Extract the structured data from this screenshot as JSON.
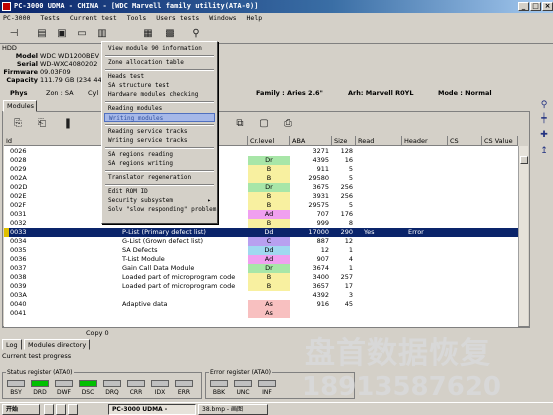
{
  "window": {
    "title": "PC-3000 UDMA - CHINA - [WDC Marvell family utility(ATA-0)]"
  },
  "menubar": [
    "PC-3000",
    "Tests",
    "Current test",
    "Tools",
    "Users tests",
    "Windows",
    "Help"
  ],
  "hdd": {
    "header": "HDD",
    "fields": [
      {
        "label": "Model",
        "value": "WDC WD1200BEV"
      },
      {
        "label": "Serial",
        "value": "WD-WXC4080202"
      },
      {
        "label": "Firmware",
        "value": "09.03F09"
      },
      {
        "label": "Capacity",
        "value": "111.79 GB (234 44"
      }
    ]
  },
  "infostrip": {
    "phys": "Phys",
    "zon": "Zon : SA",
    "cyl": "Cyl",
    "family": "Family : Aries 2.6\"",
    "arh": "Arh: Marvell R0YL",
    "mode": "Mode : Normal"
  },
  "tabs": {
    "modules": "Modules",
    "log": "Log",
    "modules_directory": "Modules directory"
  },
  "context_menu": [
    {
      "label": "View module 90 information",
      "highlight": false
    },
    {
      "sep": true
    },
    {
      "label": "Zone allocation table",
      "highlight": false
    },
    {
      "sep": true
    },
    {
      "label": "Heads test",
      "highlight": false
    },
    {
      "label": "SA structure test",
      "highlight": false
    },
    {
      "label": "Hardware modules checking",
      "highlight": false
    },
    {
      "sep": true
    },
    {
      "label": "Reading modules",
      "highlight": false
    },
    {
      "label": "Writing modules",
      "highlight": true
    },
    {
      "sep": true
    },
    {
      "label": "Reading service tracks",
      "highlight": false
    },
    {
      "label": "Writing service tracks",
      "highlight": false
    },
    {
      "sep": true
    },
    {
      "label": "SA regions reading",
      "highlight": false
    },
    {
      "label": "SA regions writing",
      "highlight": false
    },
    {
      "sep": true
    },
    {
      "label": "Translator regeneration",
      "highlight": false
    },
    {
      "sep": true
    },
    {
      "label": "Edit ROM ID",
      "highlight": false
    },
    {
      "label": "Security subsystem",
      "highlight": false,
      "submenu": true
    },
    {
      "label": "Solv \"slow responding\" problem",
      "highlight": false
    }
  ],
  "submenu_arrow": "▸",
  "chart_data": {
    "type": "table",
    "columns": [
      "Id",
      "",
      "Cr.level",
      "ABA",
      "Size",
      "Read",
      "Header",
      "CS",
      "CS Value"
    ],
    "rows": [
      {
        "id": "0026",
        "name": "",
        "level": "",
        "aba": "3271",
        "size": "128",
        "read": "",
        "header": "",
        "color": ""
      },
      {
        "id": "0028",
        "name": "",
        "level": "Dr",
        "aba": "4395",
        "size": "16",
        "read": "",
        "header": "",
        "color": "#a8e6a8"
      },
      {
        "id": "0029",
        "name": "ode",
        "level": "B",
        "aba": "911",
        "size": "5",
        "read": "",
        "header": "",
        "color": "#f8f0a0"
      },
      {
        "id": "002A",
        "name": "ode",
        "level": "B",
        "aba": "29580",
        "size": "5",
        "read": "",
        "header": "",
        "color": "#f8f0a0"
      },
      {
        "id": "002D",
        "name": "",
        "level": "Dr",
        "aba": "3675",
        "size": "256",
        "read": "",
        "header": "",
        "color": "#a8e6a8"
      },
      {
        "id": "002E",
        "name": "ode",
        "level": "B",
        "aba": "3931",
        "size": "256",
        "read": "",
        "header": "",
        "color": "#f8f0a0"
      },
      {
        "id": "002F",
        "name": "ode",
        "level": "B",
        "aba": "29575",
        "size": "5",
        "read": "",
        "header": "",
        "color": "#f8f0a0"
      },
      {
        "id": "0031",
        "name": "",
        "level": "Ad",
        "aba": "707",
        "size": "176",
        "read": "",
        "header": "",
        "color": "#f0a0f0"
      },
      {
        "id": "0032",
        "name": "Relo bad block module",
        "level": "B",
        "aba": "999",
        "size": "8",
        "read": "",
        "header": "",
        "color": "#f8f0a0"
      },
      {
        "id": "0033",
        "name": "P-List (Primary defect list)",
        "level": "Dd",
        "aba": "17000",
        "size": "290",
        "read": "Yes",
        "header": "Error",
        "color": "#a0c8f0",
        "selected": true
      },
      {
        "id": "0034",
        "name": "G-List (Grown defect list)",
        "level": "C",
        "aba": "887",
        "size": "12",
        "read": "",
        "header": "",
        "color": "#b8a0f0"
      },
      {
        "id": "0035",
        "name": "SA Defects",
        "level": "Dd",
        "aba": "12",
        "size": "1",
        "read": "",
        "header": "",
        "color": "#a0d8f0"
      },
      {
        "id": "0036",
        "name": "T-List Module",
        "level": "Ad",
        "aba": "907",
        "size": "4",
        "read": "",
        "header": "",
        "color": "#f0a0f0"
      },
      {
        "id": "0037",
        "name": "Gain Call Data Module",
        "level": "Dr",
        "aba": "3674",
        "size": "1",
        "read": "",
        "header": "",
        "color": "#a8e6a8"
      },
      {
        "id": "0038",
        "name": "Loaded part of microprogram code",
        "level": "B",
        "aba": "3400",
        "size": "257",
        "read": "",
        "header": "",
        "color": "#f8f0a0"
      },
      {
        "id": "0039",
        "name": "Loaded part of microprogram code",
        "level": "B",
        "aba": "3657",
        "size": "17",
        "read": "",
        "header": "",
        "color": "#f8f0a0"
      },
      {
        "id": "003A",
        "name": "",
        "level": "",
        "aba": "4392",
        "size": "3",
        "read": "",
        "header": "",
        "color": ""
      },
      {
        "id": "0040",
        "name": "Adaptive data",
        "level": "As",
        "aba": "916",
        "size": "45",
        "read": "",
        "header": "",
        "color": "#f8c0c0"
      },
      {
        "id": "0041",
        "name": "",
        "level": "As",
        "aba": "",
        "size": "",
        "read": "",
        "header": "",
        "color": "#f8c0c0"
      }
    ]
  },
  "copybar": "Copy 0",
  "progress": "Current test progress",
  "status_register": {
    "title": "Status register (ATA0)",
    "leds": [
      {
        "label": "BSY",
        "on": false
      },
      {
        "label": "DRD",
        "on": true
      },
      {
        "label": "DWF",
        "on": false
      },
      {
        "label": "DSC",
        "on": true
      },
      {
        "label": "DRQ",
        "on": false
      },
      {
        "label": "CRR",
        "on": false
      },
      {
        "label": "IDX",
        "on": false
      },
      {
        "label": "ERR",
        "on": false
      }
    ]
  },
  "error_register": {
    "title": "Error register (ATA0)",
    "leds": [
      {
        "label": "BBK",
        "on": false
      },
      {
        "label": "UNC",
        "on": false
      },
      {
        "label": "INF",
        "on": false
      }
    ]
  },
  "taskbar": {
    "start": "开始",
    "task1": "PC-3000 UDMA -",
    "task2": "38.bmp - 画图"
  },
  "watermark": {
    "line1": "盘首数据恢复",
    "line2": "18913587620"
  },
  "icons": {
    "toolbar": [
      "power-icon",
      "disk-icon",
      "save-icon",
      "folder-icon",
      "report-icon",
      "chip-icon",
      "grid-icon",
      "head-icon"
    ]
  }
}
